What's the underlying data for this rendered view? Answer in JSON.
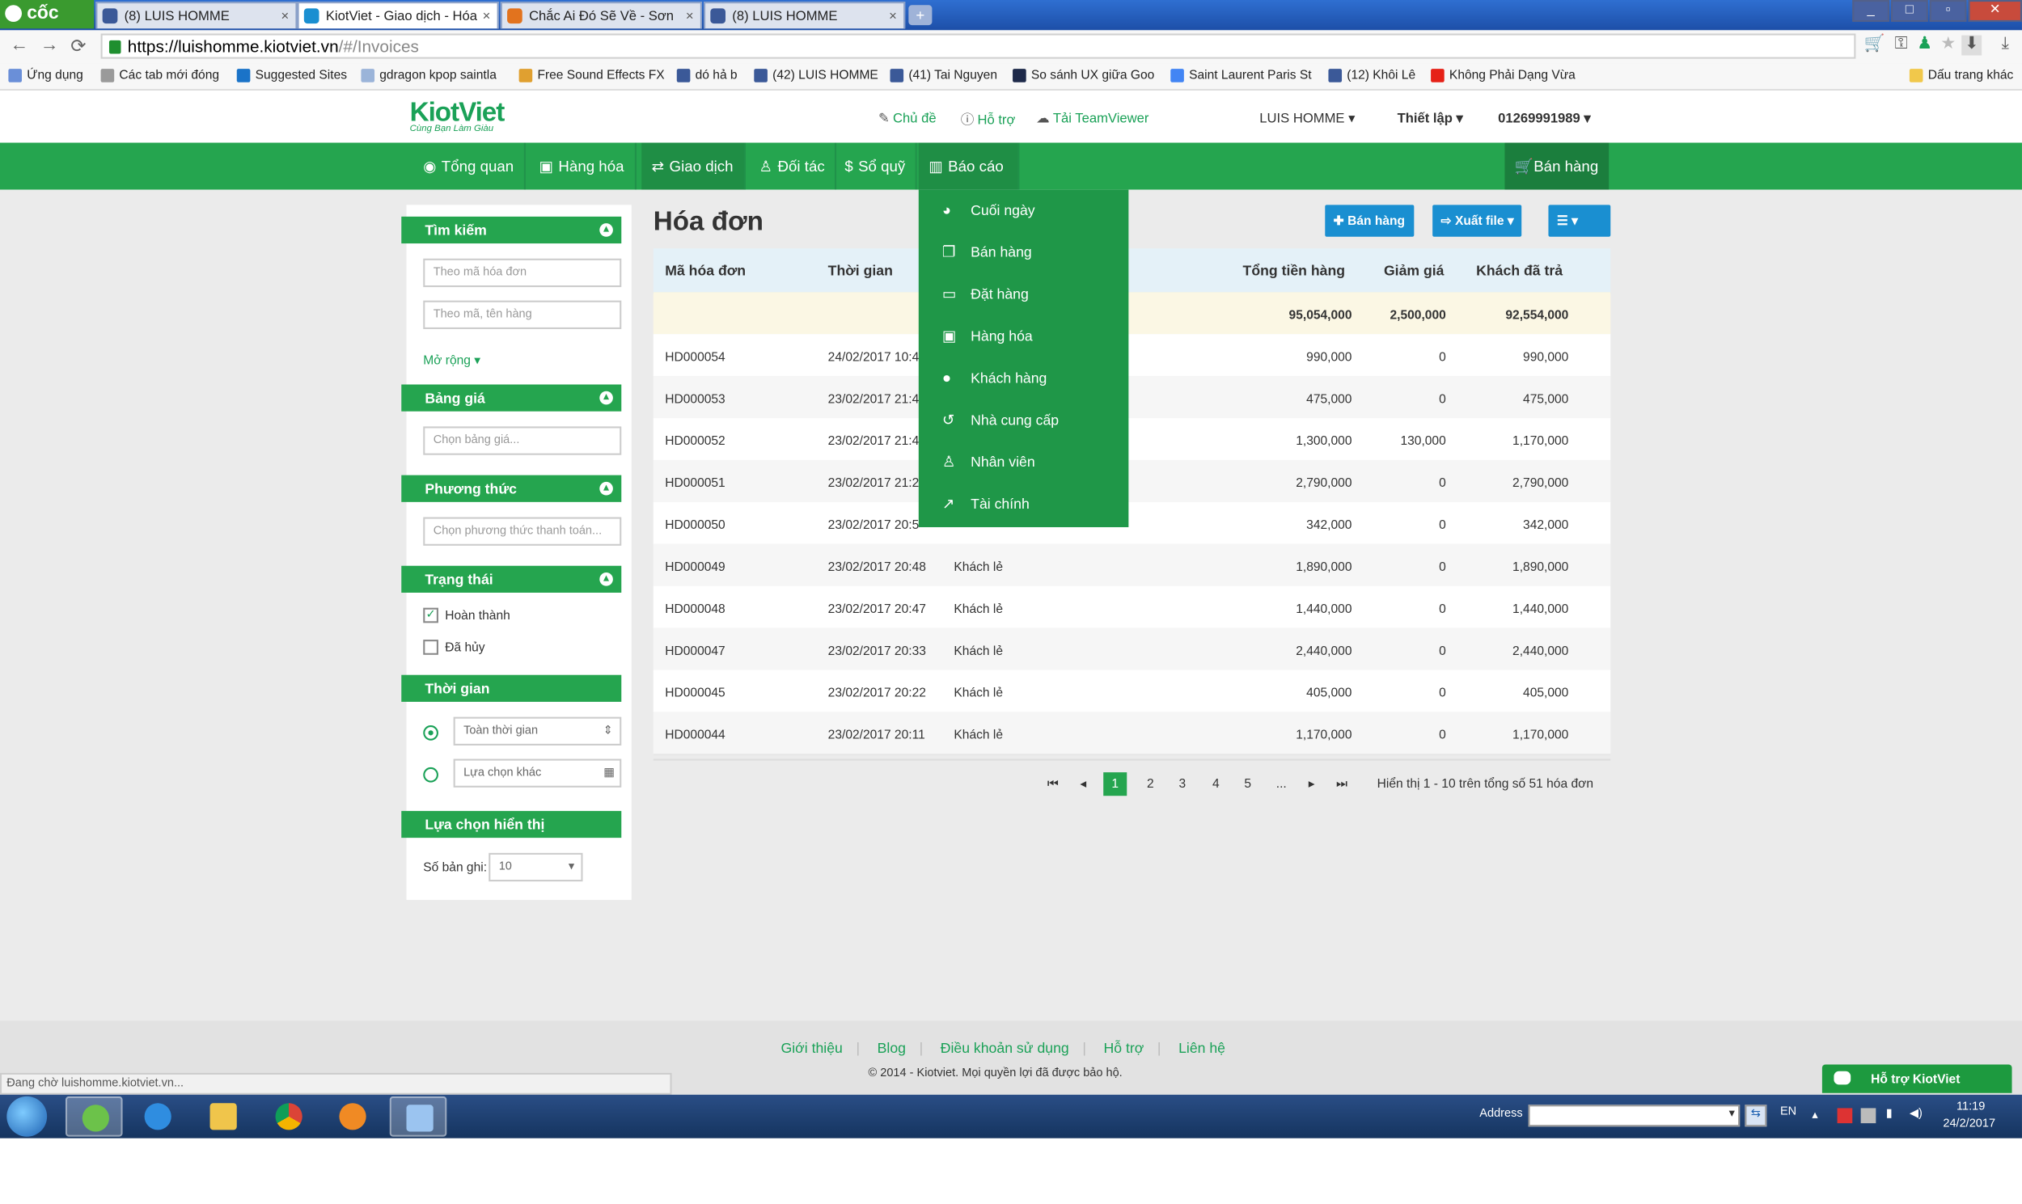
{
  "browser": {
    "brand": "cốc cốc",
    "tabs": [
      {
        "title": "(8) LUIS HOMME",
        "close": "×"
      },
      {
        "title": "KiotViet - Giao dịch - Hóa",
        "close": "×"
      },
      {
        "title": "Chắc Ai Đó Sẽ Về - Sơn",
        "close": "×"
      },
      {
        "title": "(8) LUIS HOMME",
        "close": "×"
      }
    ],
    "url_host": "https://luishomme.kiotviet.vn",
    "url_path": "/#/Invoices",
    "bookmarks": [
      "Ứng dụng",
      "Các tab mới đóng",
      "Suggested Sites",
      "gdragon kpop saintla",
      "Free Sound Effects FX",
      "dó hả b",
      "(42) LUIS HOMME",
      "(41) Tai Nguyen",
      "So sánh UX giữa Goo",
      "Saint Laurent Paris St",
      "(12) Khôi Lê",
      "Không Phải Dạng Vừa"
    ],
    "other_bookmarks": "Dấu trang khác",
    "status_text": "Đang chờ luishomme.kiotviet.vn..."
  },
  "header": {
    "logo": "KiotViet",
    "tagline": "Cùng Bạn Làm Giàu",
    "links": [
      "Chủ đề",
      "Hỗ trợ",
      "Tải TeamViewer"
    ],
    "user": "LUIS HOMME",
    "settings": "Thiết lập",
    "phone": "01269991989"
  },
  "nav": {
    "items": [
      "Tổng quan",
      "Hàng hóa",
      "Giao dịch",
      "Đối tác",
      "Sổ quỹ",
      "Báo cáo"
    ],
    "sell": "Bán hàng"
  },
  "report_menu": {
    "items": [
      "Cuối ngày",
      "Bán hàng",
      "Đặt hàng",
      "Hàng hóa",
      "Khách hàng",
      "Nhà cung cấp",
      "Nhân viên",
      "Tài chính"
    ]
  },
  "sidebar": {
    "search_title": "Tìm kiếm",
    "search_code_placeholder": "Theo mã hóa đơn",
    "search_product_placeholder": "Theo mã, tên hàng",
    "expand": "Mở rộng",
    "pricebook_title": "Bảng giá",
    "pricebook_placeholder": "Chọn bảng giá...",
    "method_title": "Phương thức",
    "method_placeholder": "Chọn phương thức thanh toán...",
    "status_title": "Trạng thái",
    "status_done": "Hoàn thành",
    "status_cancel": "Đã hủy",
    "time_title": "Thời gian",
    "time_all": "Toàn thời gian",
    "time_other": "Lựa chọn khác",
    "display_title": "Lựa chọn hiển thị",
    "records_label": "Số bản ghi:",
    "records_value": "10"
  },
  "main": {
    "title": "Hóa đơn",
    "btn_sell": "Bán hàng",
    "btn_export": "Xuất file",
    "columns": {
      "code": "Mã hóa đơn",
      "time": "Thời gian",
      "total": "Tổng tiền hàng",
      "discount": "Giảm giá",
      "paid": "Khách đã trả"
    },
    "summary": {
      "total": "95,054,000",
      "discount": "2,500,000",
      "paid": "92,554,000"
    },
    "rows": [
      {
        "code": "HD000054",
        "time": "24/02/2017 10:4",
        "customer": "",
        "total": "990,000",
        "discount": "0",
        "paid": "990,000"
      },
      {
        "code": "HD000053",
        "time": "23/02/2017 21:4",
        "customer": "",
        "total": "475,000",
        "discount": "0",
        "paid": "475,000"
      },
      {
        "code": "HD000052",
        "time": "23/02/2017 21:4",
        "customer": "",
        "total": "1,300,000",
        "discount": "130,000",
        "paid": "1,170,000"
      },
      {
        "code": "HD000051",
        "time": "23/02/2017 21:2",
        "customer": "",
        "total": "2,790,000",
        "discount": "0",
        "paid": "2,790,000"
      },
      {
        "code": "HD000050",
        "time": "23/02/2017 20:5",
        "customer": "",
        "total": "342,000",
        "discount": "0",
        "paid": "342,000"
      },
      {
        "code": "HD000049",
        "time": "23/02/2017 20:48",
        "customer": "Khách lẻ",
        "total": "1,890,000",
        "discount": "0",
        "paid": "1,890,000"
      },
      {
        "code": "HD000048",
        "time": "23/02/2017 20:47",
        "customer": "Khách lẻ",
        "total": "1,440,000",
        "discount": "0",
        "paid": "1,440,000"
      },
      {
        "code": "HD000047",
        "time": "23/02/2017 20:33",
        "customer": "Khách lẻ",
        "total": "2,440,000",
        "discount": "0",
        "paid": "2,440,000"
      },
      {
        "code": "HD000045",
        "time": "23/02/2017 20:22",
        "customer": "Khách lẻ",
        "total": "405,000",
        "discount": "0",
        "paid": "405,000"
      },
      {
        "code": "HD000044",
        "time": "23/02/2017 20:11",
        "customer": "Khách lẻ",
        "total": "1,170,000",
        "discount": "0",
        "paid": "1,170,000"
      }
    ],
    "pager": {
      "first": "⏮",
      "prev": "◂",
      "pages": [
        "1",
        "2",
        "3",
        "4",
        "5",
        "..."
      ],
      "next": "▸",
      "last": "⏭",
      "info": "Hiển thị 1 - 10 trên tổng số 51 hóa đơn"
    }
  },
  "footer": {
    "links": [
      "Giới thiệu",
      "Blog",
      "Điều khoản sử dụng",
      "Hỗ trợ",
      "Liên hệ"
    ],
    "copyright": "© 2014 - Kiotviet. Mọi quyền lợi đã được bảo hộ.",
    "support": "Hỗ trợ KiotViet"
  },
  "taskbar": {
    "address_label": "Address",
    "lang": "EN",
    "time": "11:19",
    "date": "24/2/2017"
  },
  "colors": {
    "brand_green": "#25a54f",
    "menu_green": "#1f9748",
    "accent_blue": "#1a8fd1"
  }
}
